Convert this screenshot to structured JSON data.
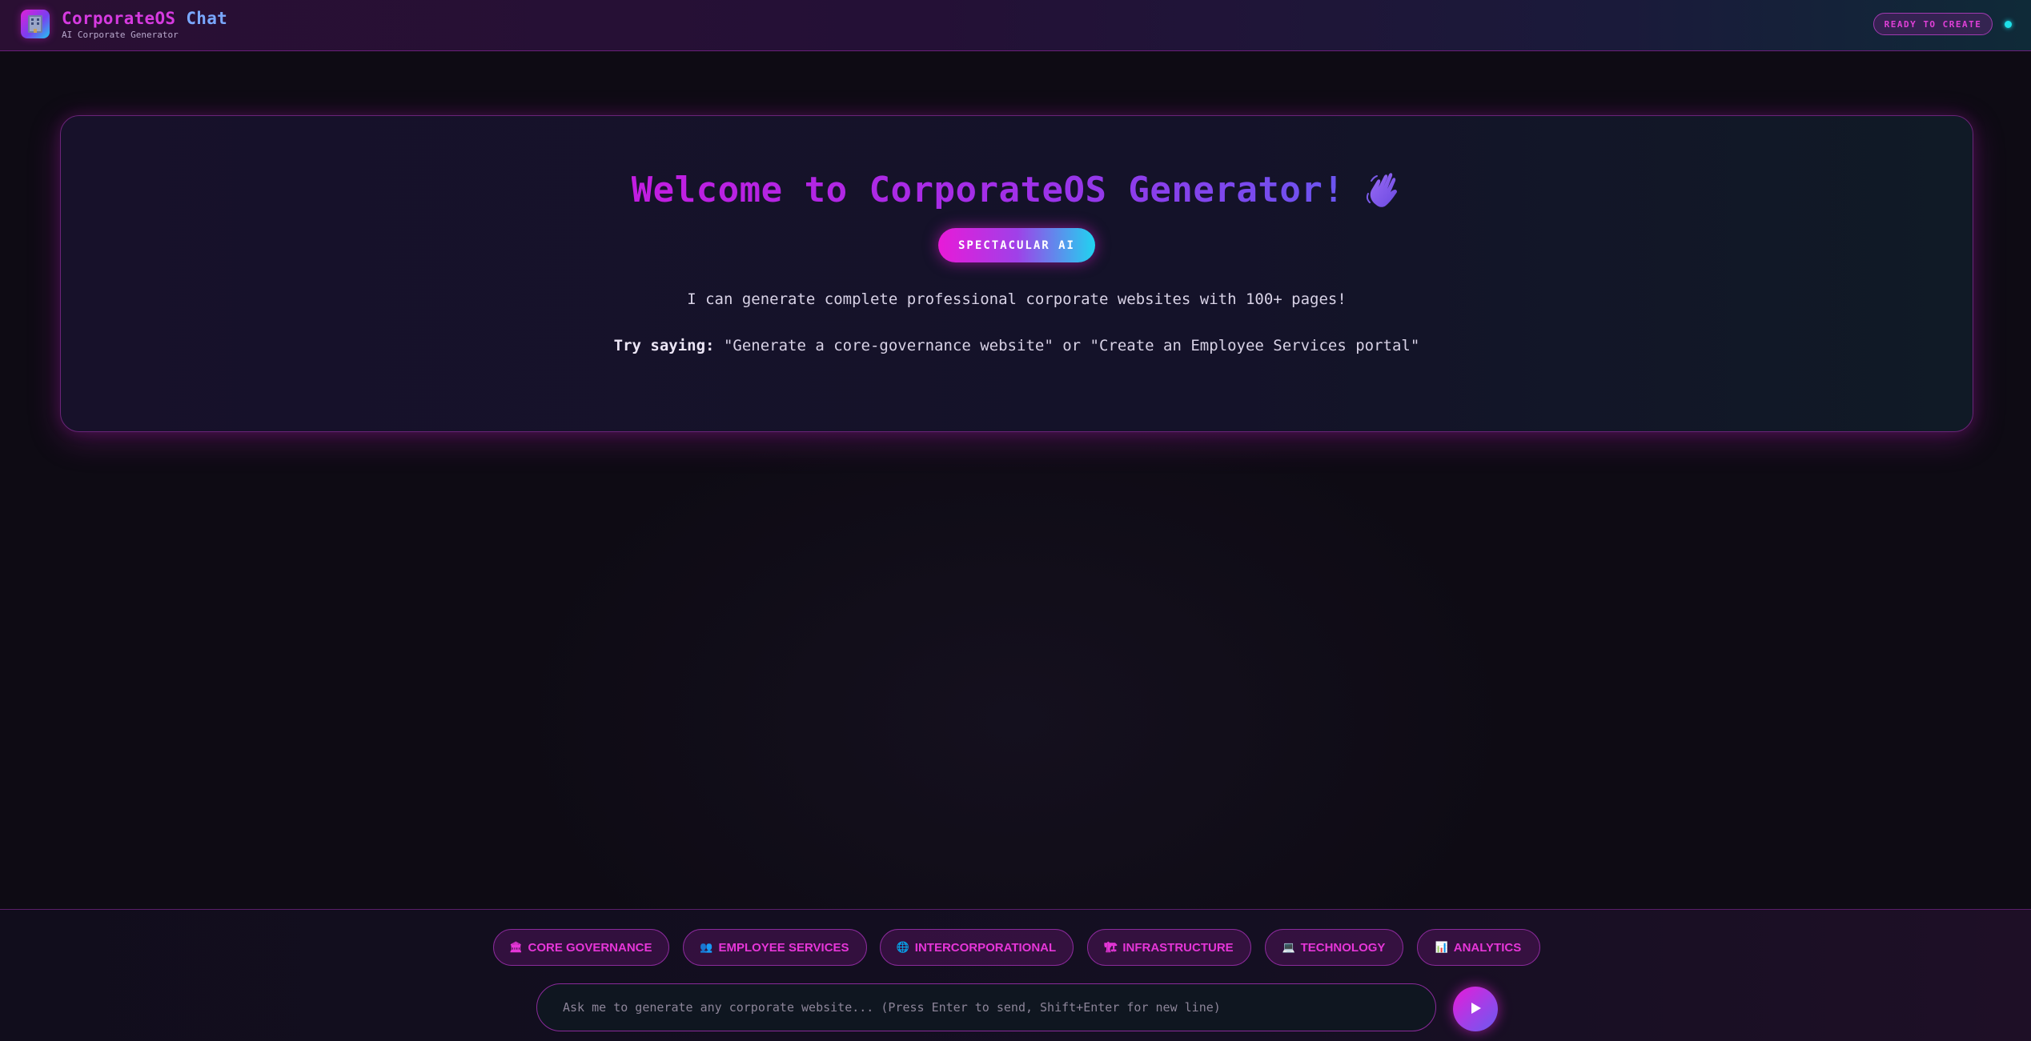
{
  "header": {
    "brand_part1": "CorporateOS",
    "brand_part2": "Chat",
    "subtitle": "AI Corporate Generator",
    "status_label": "READY TO CREATE",
    "logo_icon": "office-building-icon",
    "status_color": "#1ee0e8"
  },
  "welcome": {
    "title": "Welcome to CorporateOS Generator!",
    "title_icon": "waving-hand-icon",
    "badge": "SPECTACULAR AI",
    "description": "I can generate complete professional corporate websites with 100+ pages!",
    "try_prefix": "Try saying:",
    "try_text": "\"Generate a core-governance website\" or \"Create an Employee Services portal\""
  },
  "chips": [
    {
      "label": "CORE GOVERNANCE",
      "icon": "classical-building-icon",
      "glyph": "🏛"
    },
    {
      "label": "EMPLOYEE SERVICES",
      "icon": "people-icon",
      "glyph": "👥"
    },
    {
      "label": "INTERCORPORATIONAL",
      "icon": "globe-icon",
      "glyph": "🌐"
    },
    {
      "label": "INFRASTRUCTURE",
      "icon": "construction-icon",
      "glyph": "🏗"
    },
    {
      "label": "TECHNOLOGY",
      "icon": "laptop-icon",
      "glyph": "💻"
    },
    {
      "label": "ANALYTICS",
      "icon": "bar-chart-icon",
      "glyph": "📊"
    }
  ],
  "input": {
    "placeholder": "Ask me to generate any corporate website... (Press Enter to send, Shift+Enter for new line)",
    "value": ""
  },
  "send_icon": "play-icon",
  "colors": {
    "accent_magenta": "#e81ad8",
    "accent_purple": "#a040e8",
    "accent_cyan": "#20d4f0",
    "background": "#0e0b14"
  }
}
